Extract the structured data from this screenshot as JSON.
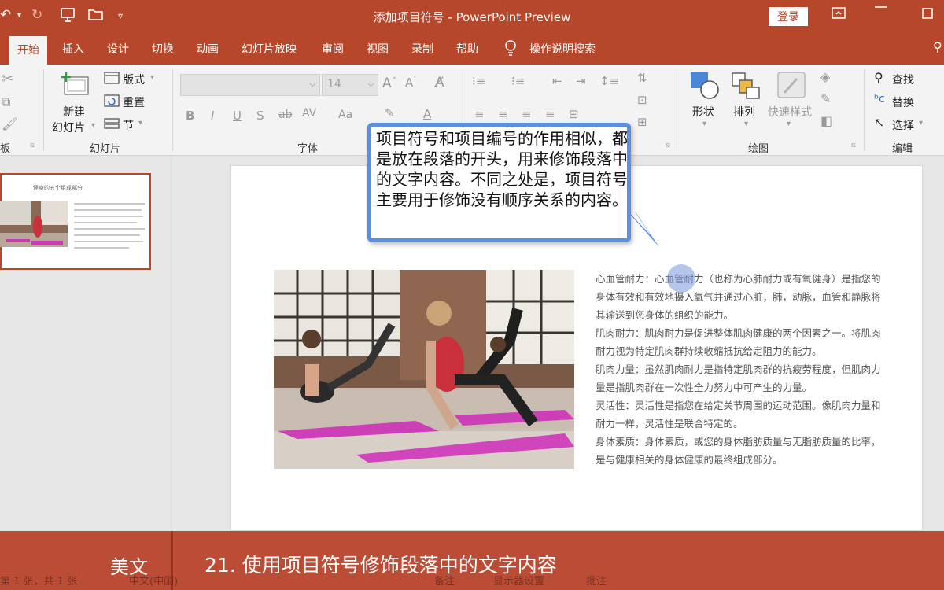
{
  "window": {
    "title": "添加项目符号 - PowerPoint Preview",
    "login_label": "登录"
  },
  "tabs": [
    {
      "label": "开始",
      "active": true
    },
    {
      "label": "插入"
    },
    {
      "label": "设计"
    },
    {
      "label": "切换"
    },
    {
      "label": "动画"
    },
    {
      "label": "幻灯片放映"
    },
    {
      "label": "审阅"
    },
    {
      "label": "视图"
    },
    {
      "label": "录制"
    },
    {
      "label": "帮助"
    }
  ],
  "tell_me": "操作说明搜索",
  "ribbon": {
    "clipboard_label": "板",
    "slides": {
      "new_slide_line1": "新建",
      "new_slide_line2": "幻灯片",
      "layout": "版式",
      "reset": "重置",
      "section": "节",
      "group_label": "幻灯片"
    },
    "font": {
      "font_size": "14",
      "group_label": "字体"
    },
    "drawing": {
      "shapes": "形状",
      "arrange": "排列",
      "quick_styles": "快速样式",
      "group_label": "绘图"
    },
    "editing": {
      "find": "查找",
      "replace": "替换",
      "select": "选择",
      "group_label": "编辑"
    }
  },
  "thumbnail": {
    "title": "健身的五个组成部分"
  },
  "slide": {
    "title_visible": "部分",
    "paragraphs": [
      "心血管耐力：心血管耐力（也称为心肺耐力或有氧健身）是指您的身体有效和有效地摄入氧气并通过心脏，肺，动脉，血管和静脉将其输送到您身体的组织的能力。",
      "肌肉耐力：肌肉耐力是促进整体肌肉健康的两个因素之一。将肌肉耐力视为特定肌肉群持续收缩抵抗给定阻力的能力。",
      "肌肉力量：虽然肌肉耐力是指特定肌肉群的抗疲劳程度，但肌肉力量是指肌肉群在一次性全力努力中可产生的力量。",
      "灵活性：灵活性是指您在给定关节周围的运动范围。像肌肉力量和耐力一样，灵活性是联合特定的。",
      "身体素质：身体素质，或您的身体脂肪质量与无脂肪质量的比率，是与健康相关的身体健康的最终组成部分。"
    ]
  },
  "callout": {
    "text": "项目符号和项目编号的作用相似，都是放在段落的开头，用来修饰段落中的文字内容。不同之处是，项目符号主要用于修饰没有顺序关系的内容。"
  },
  "caption": {
    "brand": "美文",
    "text": "21. 使用项目符号修饰段落中的文字内容"
  },
  "status": {
    "slide_count": "第 1 张，共 1 张",
    "language": "中文(中国)",
    "notes": "备注",
    "display_settings": "显示器设置",
    "comments": "批注"
  },
  "colors": {
    "brand": "#b7472a",
    "callout_border": "#5b8fe0"
  }
}
